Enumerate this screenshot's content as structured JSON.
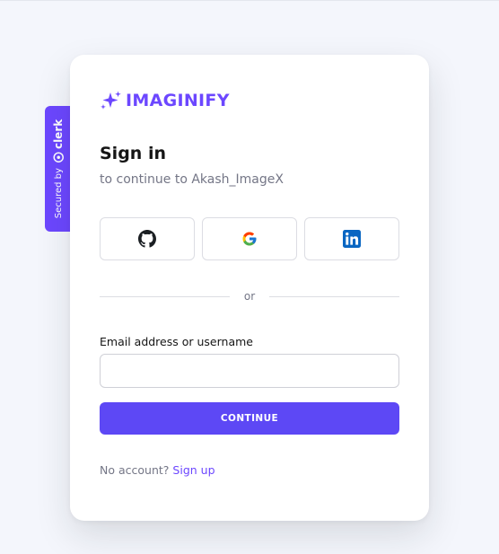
{
  "clerk_badge": {
    "secured_by": "Secured by",
    "brand": "clerk"
  },
  "app": {
    "logo_text": "IMAGINIFY"
  },
  "header": {
    "title": "Sign in",
    "subtitle": "to continue to Akash_ImageX"
  },
  "social_buttons": [
    {
      "provider": "github",
      "icon": "github-icon"
    },
    {
      "provider": "google",
      "icon": "google-icon"
    },
    {
      "provider": "linkedin",
      "icon": "linkedin-icon"
    }
  ],
  "divider": {
    "text": "or"
  },
  "form": {
    "email_label": "Email address or username",
    "email_value": "",
    "continue_label": "CONTINUE"
  },
  "footer": {
    "prompt": "No account?",
    "signup_label": "Sign up"
  },
  "colors": {
    "accent": "#6c47ff",
    "button": "#5d48f5",
    "background": "#f4f6fc"
  }
}
